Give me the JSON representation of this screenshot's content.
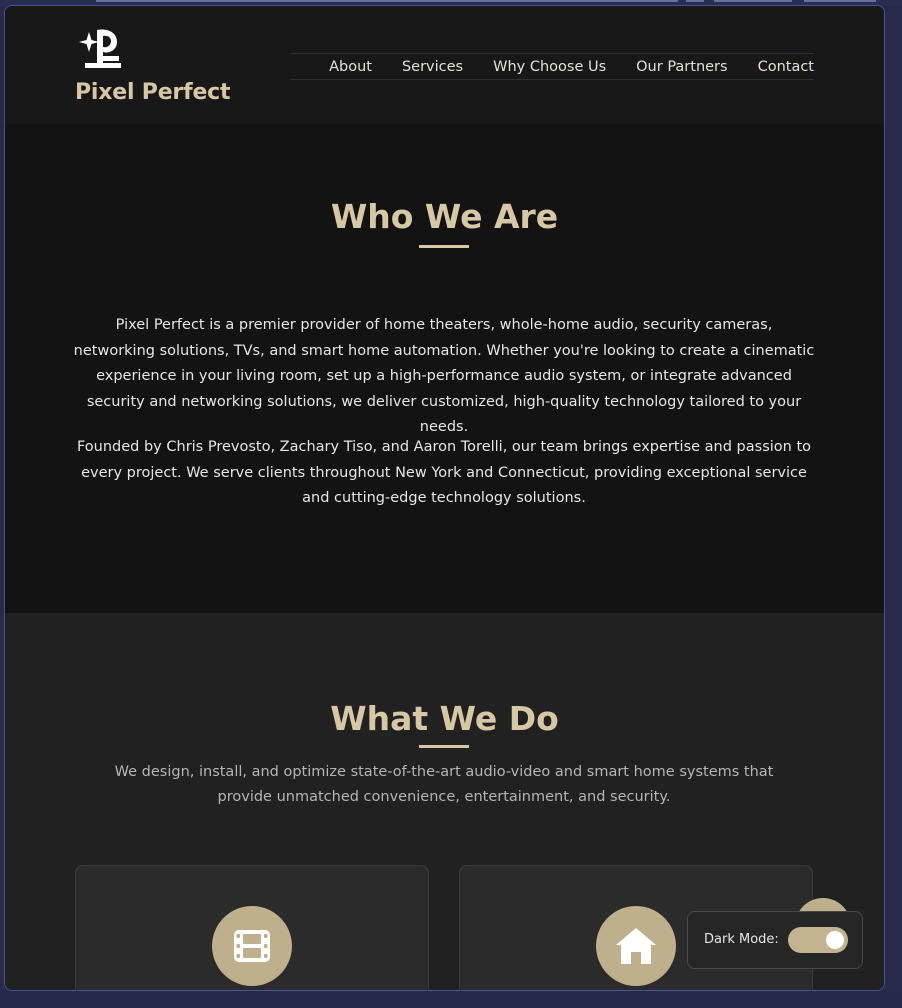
{
  "header": {
    "brand": "Pixel Perfect",
    "nav": [
      "About",
      "Services",
      "Why Choose Us",
      "Our Partners",
      "Contact"
    ]
  },
  "who": {
    "title": "Who We Are",
    "p1": "Pixel Perfect is a premier provider of home theaters, whole-home audio, security cameras, networking solutions, TVs, and smart home automation. Whether you're looking to create a cinematic experience in your living room, set up a high-performance audio system, or integrate advanced security and networking solutions, we deliver customized, high-quality technology tailored to your needs.",
    "p2": "Founded by Chris Prevosto, Zachary Tiso, and Aaron Torelli, our team brings expertise and passion to every project. We serve clients throughout New York and Connecticut, providing exceptional service and cutting-edge technology solutions."
  },
  "what": {
    "title": "What We Do",
    "subtitle": "We design, install, and optimize state-of-the-art audio-video and smart home systems that provide unmatched convenience, entertainment, and security.",
    "cards": [
      {
        "icon": "film-icon"
      },
      {
        "icon": "home-icon"
      }
    ]
  },
  "dark_mode": {
    "label": "Dark Mode:",
    "enabled": true
  },
  "colors": {
    "accent": "#d7c7a5",
    "icon_bg": "#bfb08d",
    "bg_dark": "#131313",
    "bg_section": "#212121"
  }
}
